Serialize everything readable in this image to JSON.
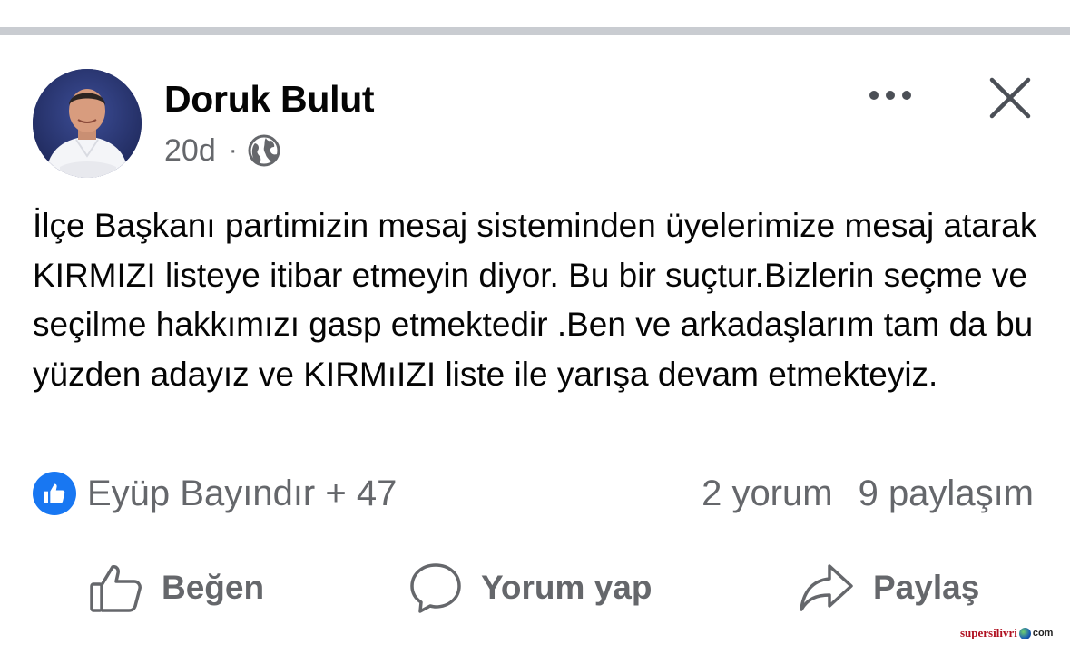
{
  "post": {
    "author": "Doruk Bulut",
    "time": "20d",
    "separator": "·",
    "audience_icon": "globe-icon",
    "body": "İlçe Başkanı partimizin mesaj sisteminden üyelerimize mesaj atarak KIRMIZI listeye itibar etmeyin diyor. Bu bir suçtur.Bizlerin seçme ve seçilme hakkımızı gasp etmektedir .Ben ve arkadaşlarım tam da bu yüzden adayız ve KIRMıIZI liste ile yarışa devam etmekteyiz."
  },
  "header_actions": {
    "more_icon": "more-dots-icon",
    "close_icon": "close-icon"
  },
  "reactions": {
    "icon": "like-badge-icon",
    "text": "Eyüp Bayındır + 47",
    "comments": "2 yorum",
    "shares": "9 paylaşım"
  },
  "actions": {
    "like": "Beğen",
    "comment": "Yorum yap",
    "share": "Paylaş"
  },
  "watermark": {
    "name": "supersilivri",
    "tld": "com"
  },
  "colors": {
    "text": "#050505",
    "secondary": "#65676b",
    "like_blue": "#1877f2",
    "divider": "#c9ccd1"
  }
}
